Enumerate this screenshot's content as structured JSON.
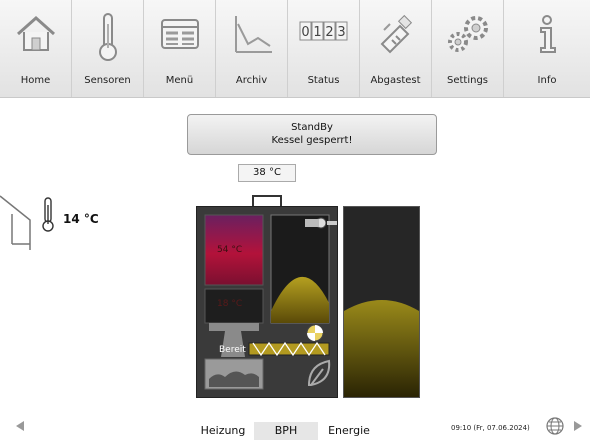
{
  "nav": {
    "items": [
      {
        "label": "Home",
        "icon": "home-icon"
      },
      {
        "label": "Sensoren",
        "icon": "thermometer-icon"
      },
      {
        "label": "Menü",
        "icon": "menu-icon"
      },
      {
        "label": "Archiv",
        "icon": "chart-icon"
      },
      {
        "label": "Status",
        "icon": "counter-icon",
        "display": "0123"
      },
      {
        "label": "Abgastest",
        "icon": "flue-test-icon"
      },
      {
        "label": "Settings",
        "icon": "gears-icon"
      },
      {
        "label": "Info",
        "icon": "info-icon"
      }
    ]
  },
  "status": {
    "line1": "StandBy",
    "line2": "Kessel gesperrt!"
  },
  "flue_temperature": "38 °C",
  "outside_temperature": "14 °C",
  "boiler": {
    "upper_temp": "54 °C",
    "lower_temp": "18 °C",
    "state_label": "Bereit"
  },
  "footer": {
    "tabs": [
      {
        "label": "Heizung",
        "active": false
      },
      {
        "label": "BPH",
        "active": true
      },
      {
        "label": "Energie",
        "active": false
      }
    ],
    "datetime": "09:10 (Fr, 07.06.2024)"
  },
  "colors": {
    "boiler_hot": "#b3123a",
    "pellet": "#a08a10",
    "casing": "#3a3a3a"
  }
}
